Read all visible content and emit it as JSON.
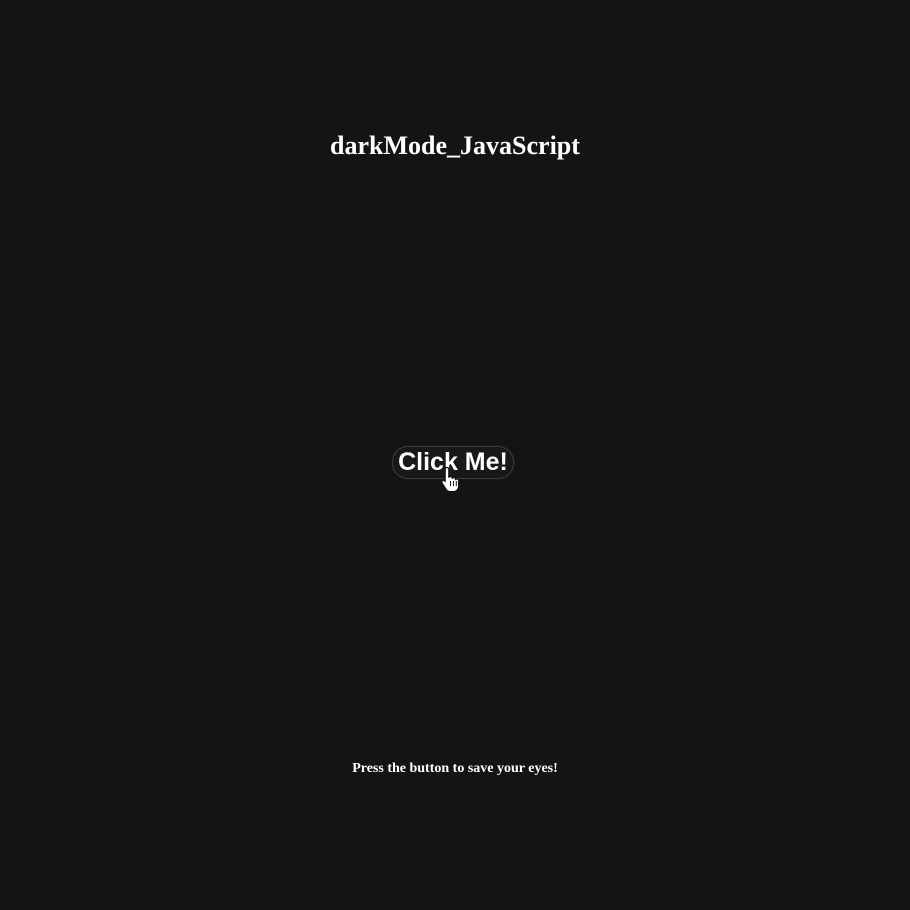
{
  "page": {
    "title": "darkMode_JavaScript",
    "button_label": "Click Me!",
    "footer_text": "Press the button to save your eyes!"
  },
  "cursor": {
    "icon": "hand-pointer-icon"
  },
  "colors": {
    "background": "#141414",
    "text": "#ffffff",
    "button_background": "#181818",
    "button_border": "#3a3a3a"
  }
}
